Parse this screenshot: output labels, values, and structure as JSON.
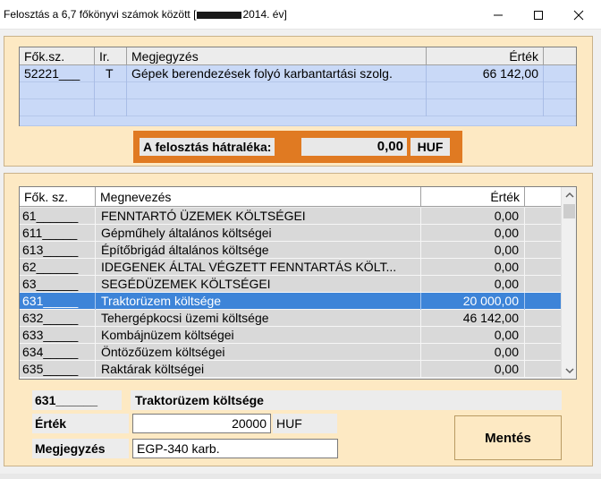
{
  "window": {
    "title_prefix": "Felosztás a 6,7 főkönyvi számok között  [",
    "title_suffix": "2014. év]",
    "minimize_icon": "minimize-icon",
    "maximize_icon": "maximize-icon",
    "close_icon": "close-icon"
  },
  "top_table": {
    "columns": [
      "Fők.sz.",
      "Ir.",
      "Megjegyzés",
      "Érték"
    ],
    "rows": [
      {
        "code": "52221___",
        "ir": "T",
        "note": "Gépek berendezések folyó karbantartási szolg.",
        "value": "66 142,00"
      }
    ]
  },
  "remainder": {
    "label": "A felosztás hátraléka:",
    "value": "0,00",
    "currency": "HUF"
  },
  "account_list": {
    "columns": [
      "Fők. sz.",
      "Megnevezés",
      "Érték"
    ],
    "rows": [
      {
        "code": "61______",
        "name": "FENNTARTÓ ÜZEMEK KÖLTSÉGEI",
        "value": "0,00",
        "selected": false
      },
      {
        "code": "611_____",
        "name": "Gépműhely általános költségei",
        "value": "0,00",
        "selected": false
      },
      {
        "code": "613_____",
        "name": "Építőbrigád általános költsége",
        "value": "0,00",
        "selected": false
      },
      {
        "code": "62______",
        "name": "IDEGENEK ÁLTAL VÉGZETT FENNTARTÁS KÖLT...",
        "value": "0,00",
        "selected": false
      },
      {
        "code": "63______",
        "name": "SEGÉDÜZEMEK KÖLTSÉGEI",
        "value": "0,00",
        "selected": false
      },
      {
        "code": "631_____",
        "name": "Traktorüzem  költsége",
        "value": "20 000,00",
        "selected": true
      },
      {
        "code": "632_____",
        "name": "Tehergépkocsi üzemi költsége",
        "value": "46 142,00",
        "selected": false
      },
      {
        "code": "633_____",
        "name": "Kombájnüzem költségei",
        "value": "0,00",
        "selected": false
      },
      {
        "code": "634_____",
        "name": "Öntözőüzem költségei",
        "value": "0,00",
        "selected": false
      },
      {
        "code": "635_____",
        "name": "Raktárak költségei",
        "value": "0,00",
        "selected": false
      }
    ],
    "scroll_up_icon": "scroll-up-icon",
    "scroll_down_icon": "scroll-down-icon"
  },
  "detail": {
    "code": "631______",
    "name": "Traktorüzem költsége",
    "value_label": "Érték",
    "value": "20000",
    "unit": "HUF",
    "note_label": "Megjegyzés",
    "note": "EGP-340 karb."
  },
  "save_button": {
    "label": "Mentés"
  },
  "colors": {
    "panel": "#fde9c3",
    "remainder_frame": "#e07a22",
    "selection": "#3d84d8",
    "top_row": "#c9d9f7"
  }
}
